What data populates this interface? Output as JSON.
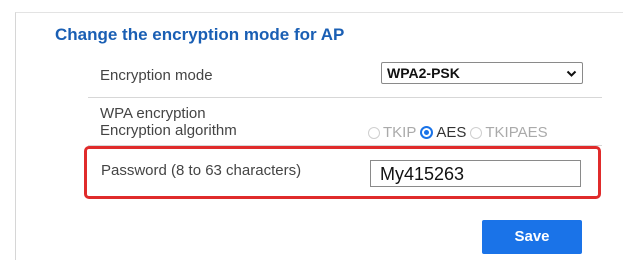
{
  "section": {
    "title": "Change the encryption mode for AP"
  },
  "encryption_mode": {
    "label": "Encryption mode",
    "selected": "WPA2-PSK"
  },
  "wpa": {
    "label_line1": "WPA encryption",
    "label_line2": "Encryption algorithm",
    "options": [
      "TKIP",
      "AES",
      "TKIPAES"
    ],
    "selected": "AES"
  },
  "password": {
    "label": "Password (8 to 63 characters)",
    "value": "My415263"
  },
  "save_label": "Save",
  "colors": {
    "title": "#1a5fb4",
    "accent": "#1a73e8",
    "highlight": "#e02b2b"
  }
}
